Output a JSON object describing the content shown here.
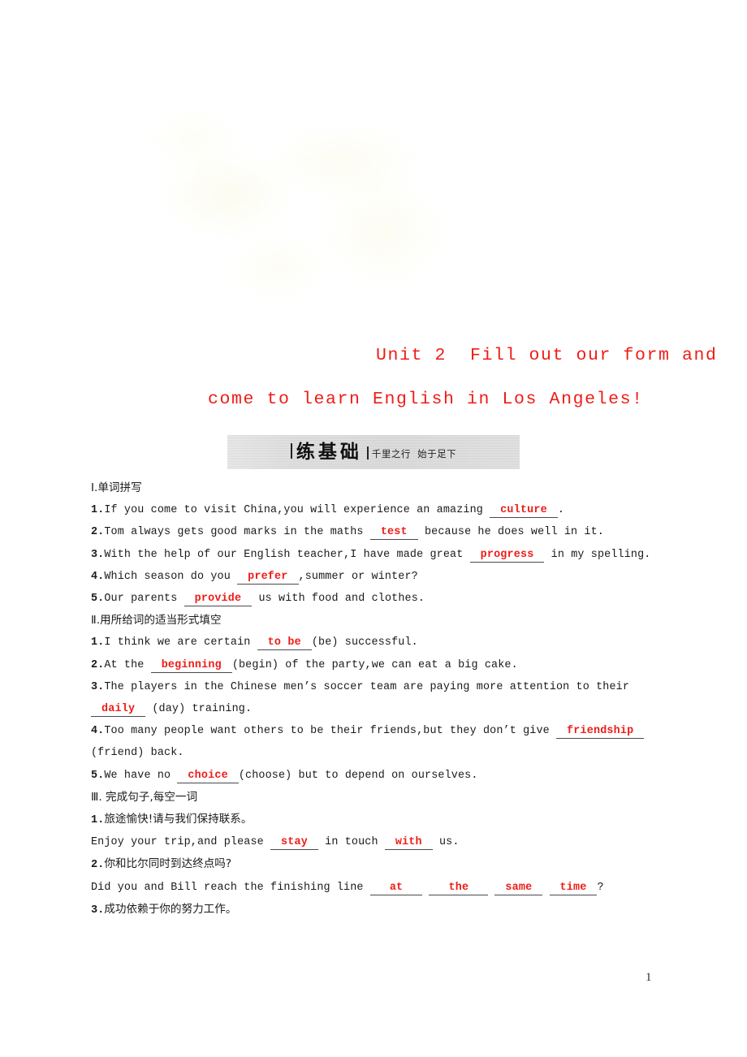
{
  "page": {
    "number": "1",
    "watermark": "faint-yellow-blotch"
  },
  "title": {
    "line1": "Unit 2  Fill out our form and",
    "line2": "come to learn English in Los Angeles!",
    "color": "#ee1c17"
  },
  "banner": {
    "title": "练基础",
    "subtitle": "千里之行  始于足下",
    "background_color": "#d8d8d8"
  },
  "sections": [
    {
      "heading": "Ⅰ.单词拼写",
      "items": [
        {
          "number": "1.",
          "parts": [
            {
              "t": "text",
              "v": "If you come to visit China,you will experience an amazing "
            },
            {
              "t": "blank",
              "v": "culture"
            },
            {
              "t": "text",
              "v": "."
            }
          ]
        },
        {
          "number": "2.",
          "parts": [
            {
              "t": "text",
              "v": "Tom always gets good marks in the maths "
            },
            {
              "t": "blank",
              "v": "test"
            },
            {
              "t": "text",
              "v": " because he does well in it."
            }
          ]
        },
        {
          "number": "3.",
          "parts": [
            {
              "t": "text",
              "v": "With the help of our English teacher,I have made great "
            },
            {
              "t": "blank",
              "v": "progress"
            },
            {
              "t": "text",
              "v": " in my spelling."
            }
          ]
        },
        {
          "number": "4.",
          "parts": [
            {
              "t": "text",
              "v": "Which season do you "
            },
            {
              "t": "blank",
              "v": "prefer"
            },
            {
              "t": "text",
              "v": ",summer or winter?"
            }
          ]
        },
        {
          "number": "5.",
          "parts": [
            {
              "t": "text",
              "v": "Our parents "
            },
            {
              "t": "blank",
              "v": "provide"
            },
            {
              "t": "text",
              "v": " us with food and clothes."
            }
          ]
        }
      ]
    },
    {
      "heading": "Ⅱ.用所给词的适当形式填空",
      "items": [
        {
          "number": "1.",
          "parts": [
            {
              "t": "text",
              "v": "I think we are certain "
            },
            {
              "t": "blank",
              "v": "to be"
            },
            {
              "t": "text",
              "v": "(be) successful."
            }
          ]
        },
        {
          "number": "2.",
          "parts": [
            {
              "t": "text",
              "v": "At the "
            },
            {
              "t": "blank",
              "v": "beginning"
            },
            {
              "t": "text",
              "v": "(begin) of the party,we can eat a big cake."
            }
          ]
        },
        {
          "number": "3.",
          "parts": [
            {
              "t": "text",
              "v": "The players in the Chinese men’s soccer team are paying more attention to their "
            },
            {
              "t": "blank",
              "v": "daily"
            },
            {
              "t": "text",
              "v": " (day) training."
            }
          ]
        },
        {
          "number": "4.",
          "parts": [
            {
              "t": "text",
              "v": "Too many people want others to be their friends,but they don’t give "
            },
            {
              "t": "blank",
              "v": "friendship"
            },
            {
              "t": "text",
              "v": " (friend) back."
            }
          ]
        },
        {
          "number": "5.",
          "parts": [
            {
              "t": "text",
              "v": "We have no "
            },
            {
              "t": "blank",
              "v": "choice"
            },
            {
              "t": "text",
              "v": "(choose) but to depend on ourselves."
            }
          ]
        }
      ]
    },
    {
      "heading": "Ⅲ. 完成句子,每空一词",
      "items": [
        {
          "number": "1.",
          "chinese": "旅途愉快!请与我们保持联系。"
        },
        {
          "number": "",
          "parts": [
            {
              "t": "text",
              "v": "Enjoy your trip,and please "
            },
            {
              "t": "blank",
              "v": "stay"
            },
            {
              "t": "text",
              "v": " in touch "
            },
            {
              "t": "blank",
              "v": "with"
            },
            {
              "t": "text",
              "v": " us."
            }
          ]
        },
        {
          "number": "2.",
          "chinese": "你和比尔同时到达终点吗?"
        },
        {
          "number": "",
          "parts": [
            {
              "t": "text",
              "v": "Did you and Bill reach the finishing line "
            },
            {
              "t": "blank_wide",
              "v": "at"
            },
            {
              "t": "text",
              "v": " "
            },
            {
              "t": "blank_wide",
              "v": "the"
            },
            {
              "t": "text",
              "v": " "
            },
            {
              "t": "blank",
              "v": "same"
            },
            {
              "t": "text",
              "v": " "
            },
            {
              "t": "blank",
              "v": "time"
            },
            {
              "t": "text",
              "v": "?"
            }
          ]
        },
        {
          "number": "3.",
          "chinese": "成功依赖于你的努力工作。"
        }
      ]
    }
  ]
}
